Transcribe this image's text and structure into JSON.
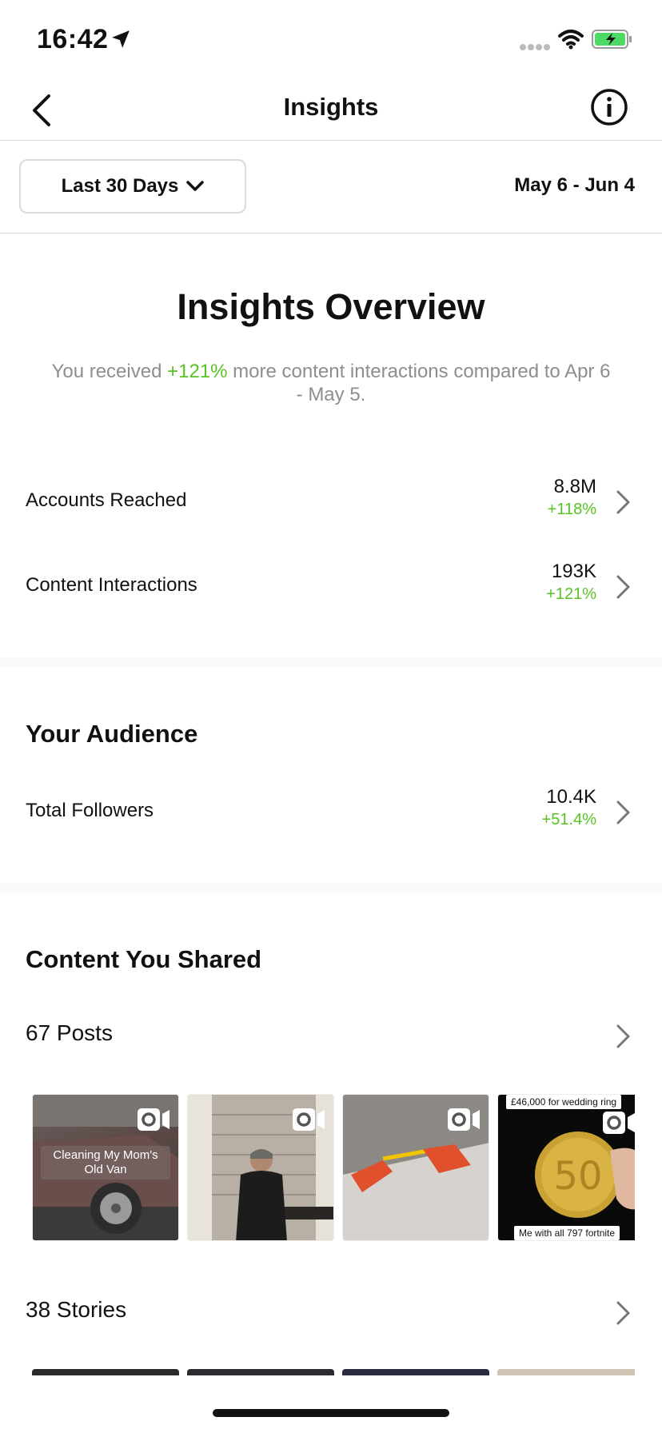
{
  "status_bar": {
    "time": "16:42"
  },
  "nav": {
    "title": "Insights"
  },
  "filter": {
    "range_label": "Last 30 Days",
    "date_range": "May 6 - Jun 4"
  },
  "overview": {
    "title": "Insights Overview",
    "sub_prefix": "You received ",
    "sub_highlight": "+121%",
    "sub_suffix": " more content interactions compared to Apr 6 - May 5.",
    "metrics": [
      {
        "label": "Accounts Reached",
        "value": "8.8M",
        "change": "+118%"
      },
      {
        "label": "Content Interactions",
        "value": "193K",
        "change": "+121%"
      }
    ]
  },
  "audience": {
    "title": "Your Audience",
    "metrics": [
      {
        "label": "Total Followers",
        "value": "10.4K",
        "change": "+51.4%"
      }
    ]
  },
  "content": {
    "title": "Content You Shared",
    "posts_label": "67 Posts",
    "stories_label": "38 Stories",
    "thumbnails": [
      {
        "caption": "Cleaning My Mom's Old Van"
      },
      {
        "caption": ""
      },
      {
        "caption": ""
      },
      {
        "top_text": "£46,000 for wedding ring",
        "bottom_text": "Me with all 797 fortnite"
      }
    ]
  },
  "colors": {
    "positive": "#58c322",
    "muted": "#8e8e8e",
    "border": "#dbdbdb"
  }
}
